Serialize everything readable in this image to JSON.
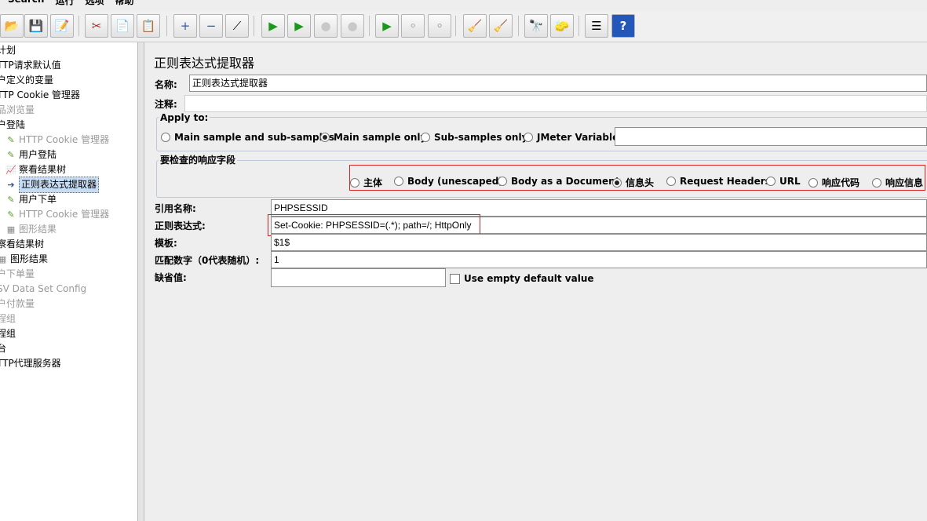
{
  "menubar": [
    "Search",
    "运行",
    "选项",
    "帮助"
  ],
  "toolbar": {
    "buttons": [
      {
        "name": "open-icon",
        "glyph": "📂"
      },
      {
        "name": "save-icon",
        "glyph": "💾"
      },
      {
        "name": "edit-icon",
        "glyph": "📝"
      },
      {
        "name": "cut-icon",
        "glyph": "✂"
      },
      {
        "name": "copy-icon",
        "glyph": "📄"
      },
      {
        "name": "paste-icon",
        "glyph": "📋"
      },
      {
        "name": "expand-icon",
        "glyph": "+"
      },
      {
        "name": "collapse-icon",
        "glyph": "−"
      },
      {
        "name": "toggle-icon",
        "glyph": "⟋"
      },
      {
        "name": "start-icon",
        "glyph": "▶"
      },
      {
        "name": "start-no-pause-icon",
        "glyph": "▶"
      },
      {
        "name": "stop-icon",
        "glyph": "●"
      },
      {
        "name": "shutdown-icon",
        "glyph": "●"
      },
      {
        "name": "remote-start-icon",
        "glyph": "▶"
      },
      {
        "name": "remote-stop-icon",
        "glyph": "⚬"
      },
      {
        "name": "remote-shutdown-icon",
        "glyph": "⚬"
      },
      {
        "name": "clear-icon",
        "glyph": "🧹"
      },
      {
        "name": "clear-all-icon",
        "glyph": "🧹"
      },
      {
        "name": "search-icon",
        "glyph": "🔭"
      },
      {
        "name": "reset-search-icon",
        "glyph": "🧽"
      },
      {
        "name": "function-helper-icon",
        "glyph": "☰"
      },
      {
        "name": "help-icon",
        "glyph": "?"
      }
    ]
  },
  "tree": {
    "items": [
      {
        "label": "计划",
        "indent": 0,
        "dim": false,
        "icon": ""
      },
      {
        "label": "TTP请求默认值",
        "indent": 0,
        "dim": false,
        "icon": ""
      },
      {
        "label": "户定义的变量",
        "indent": 0,
        "dim": false,
        "icon": ""
      },
      {
        "label": "TTP Cookie 管理器",
        "indent": 0,
        "dim": false,
        "icon": ""
      },
      {
        "label": "品浏览量",
        "indent": 0,
        "dim": true,
        "icon": ""
      },
      {
        "label": "户登陆",
        "indent": 0,
        "dim": false,
        "icon": ""
      },
      {
        "label": "HTTP Cookie 管理器",
        "indent": 10,
        "dim": true,
        "icon": "✎"
      },
      {
        "label": "用户登陆",
        "indent": 10,
        "dim": false,
        "icon": "✎"
      },
      {
        "label": "察看结果树",
        "indent": 10,
        "dim": false,
        "icon": "📈"
      },
      {
        "label": "正则表达式提取器",
        "indent": 10,
        "dim": false,
        "icon": "➔",
        "selected": true
      },
      {
        "label": "用户下单",
        "indent": 10,
        "dim": false,
        "icon": "✎"
      },
      {
        "label": "HTTP Cookie 管理器",
        "indent": 10,
        "dim": true,
        "icon": "✎"
      },
      {
        "label": "图形结果",
        "indent": 10,
        "dim": true,
        "icon": "▦"
      },
      {
        "label": "察看结果树",
        "indent": 0,
        "dim": false,
        "icon": ""
      },
      {
        "label": "图形结果",
        "indent": 0,
        "dim": false,
        "icon": "▦"
      },
      {
        "label": "户下单量",
        "indent": 0,
        "dim": true,
        "icon": ""
      },
      {
        "label": "SV Data Set Config",
        "indent": 0,
        "dim": true,
        "icon": ""
      },
      {
        "label": "户付款量",
        "indent": 0,
        "dim": true,
        "icon": ""
      },
      {
        "label": "程组",
        "indent": 0,
        "dim": true,
        "icon": ""
      },
      {
        "label": "程组",
        "indent": 0,
        "dim": false,
        "icon": ""
      },
      {
        "label": "台",
        "indent": 0,
        "dim": false,
        "icon": ""
      },
      {
        "label": "TTP代理服务器",
        "indent": 0,
        "dim": false,
        "icon": ""
      }
    ]
  },
  "panel": {
    "title": "正则表达式提取器",
    "name_label": "名称:",
    "name_value": "正则表达式提取器",
    "comment_label": "注释:",
    "comment_value": "",
    "apply_to_title": "Apply to:",
    "apply_to_options": [
      {
        "label": "Main sample and sub-samples",
        "checked": false
      },
      {
        "label": "Main sample only",
        "checked": true
      },
      {
        "label": "Sub-samples only",
        "checked": false
      },
      {
        "label": "JMeter Variable",
        "checked": false
      }
    ],
    "jmeter_variable_value": "",
    "field_title": "要检查的响应字段",
    "field_options": [
      {
        "label": "主体",
        "checked": false
      },
      {
        "label": "Body (unescaped)",
        "checked": false
      },
      {
        "label": "Body as a Document",
        "checked": false
      },
      {
        "label": "信息头",
        "checked": true
      },
      {
        "label": "Request Headers",
        "checked": false
      },
      {
        "label": "URL",
        "checked": false
      },
      {
        "label": "响应代码",
        "checked": false
      },
      {
        "label": "响应信息",
        "checked": false
      }
    ],
    "ref_name_label": "引用名称:",
    "ref_name_value": "PHPSESSID",
    "regex_label": "正则表达式:",
    "regex_value": "Set-Cookie: PHPSESSID=(.*); path=/; HttpOnly",
    "template_label": "模板:",
    "template_value": "$1$",
    "match_no_label": "匹配数字（0代表随机）:",
    "match_no_value": "1",
    "default_label": "缺省值:",
    "default_value": "",
    "use_empty_label": "Use empty default value"
  }
}
